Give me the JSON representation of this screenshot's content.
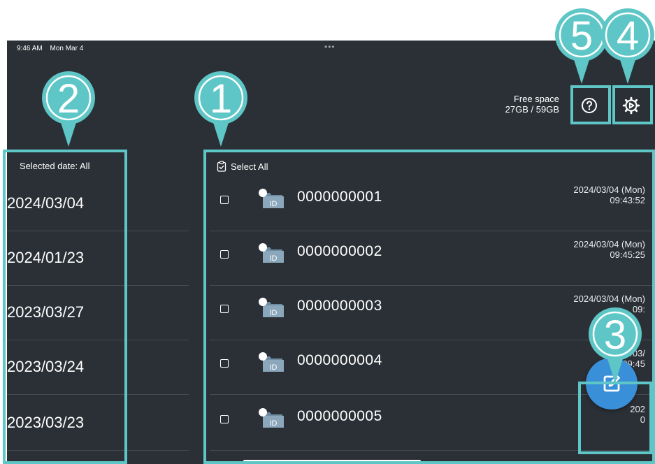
{
  "status_bar": {
    "time": "9:46 AM",
    "date": "Mon Mar 4",
    "dots": "•••"
  },
  "header": {
    "free_space_label": "Free space",
    "free_space_value": "27GB / 59GB",
    "help_icon": "help-circle-icon",
    "settings_icon": "gear-icon"
  },
  "dates": {
    "label": "Selected date: All",
    "items": [
      "2024/03/04",
      "2024/01/23",
      "2023/03/27",
      "2023/03/24",
      "2023/03/23"
    ]
  },
  "records": {
    "select_all_label": "Select All",
    "rows": [
      {
        "id": "0000000001",
        "date": "2024/03/04 (Mon)",
        "time": "09:43:52"
      },
      {
        "id": "0000000002",
        "date": "2024/03/04 (Mon)",
        "time": "09:45:25"
      },
      {
        "id": "0000000003",
        "date": "2024/03/04 (Mon)",
        "time": "09:"
      },
      {
        "id": "0000000004",
        "date": "2024/03/",
        "time": "09:45"
      },
      {
        "id": "0000000005",
        "date": "202",
        "time": "0"
      }
    ],
    "folder_badge": "ID"
  },
  "fab": {
    "icon": "edit-icon"
  },
  "annotations": {
    "markers": [
      "1",
      "2",
      "3",
      "4",
      "5"
    ],
    "color": "#5ec6c6"
  },
  "colors": {
    "background": "#2b3036",
    "accent": "#3a8fd9",
    "highlight": "#5ec6c6"
  }
}
